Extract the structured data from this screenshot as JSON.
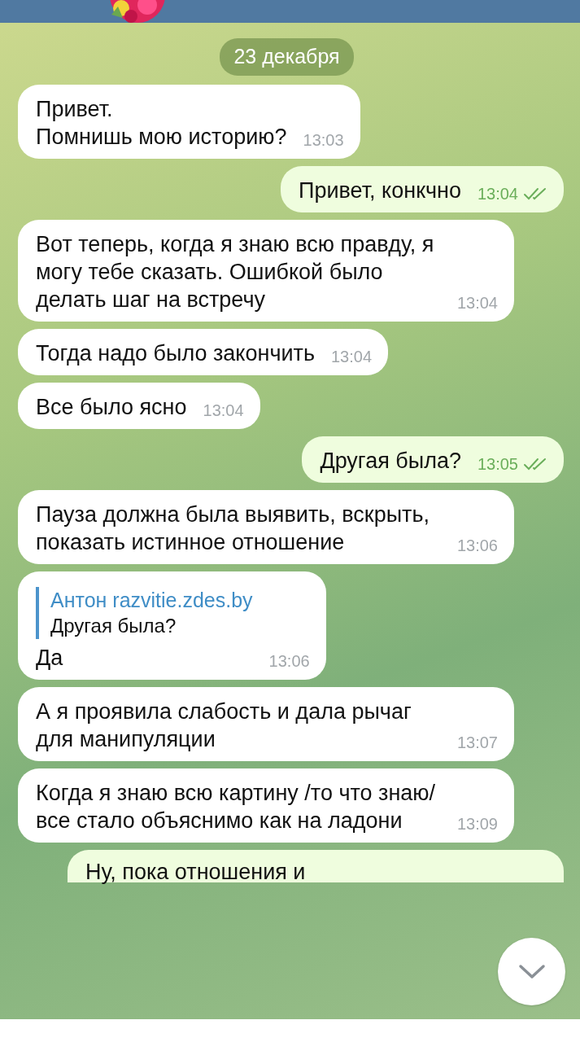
{
  "date_divider": "23 декабря",
  "messages": [
    {
      "kind": "text",
      "outgoing": false,
      "text": "Привет.\nПомнишь мою историю?",
      "time": "13:03"
    },
    {
      "kind": "text",
      "outgoing": true,
      "read": true,
      "text": "Привет, конкчно",
      "time": "13:04"
    },
    {
      "kind": "text",
      "outgoing": false,
      "text": "Вот теперь, когда я знаю всю правду, я могу тебе сказать. Ошибкой было делать шаг на встречу",
      "time": "13:04"
    },
    {
      "kind": "text",
      "outgoing": false,
      "text": "Тогда надо было закончить",
      "time": "13:04"
    },
    {
      "kind": "text",
      "outgoing": false,
      "text": "Все было ясно",
      "time": "13:04"
    },
    {
      "kind": "text",
      "outgoing": true,
      "read": true,
      "text": "Другая была?",
      "time": "13:05"
    },
    {
      "kind": "text",
      "outgoing": false,
      "text": "Пауза должна была выявить, вскрыть, показать истинное отношение",
      "time": "13:06"
    },
    {
      "kind": "reply",
      "outgoing": false,
      "quote_author": "Антон razvitie.zdes.by",
      "quote_text": "Другая была?",
      "text": "Да",
      "time": "13:06"
    },
    {
      "kind": "text",
      "outgoing": false,
      "text": "А я проявила слабость и дала рычаг для манипуляции",
      "time": "13:07"
    },
    {
      "kind": "text",
      "outgoing": false,
      "text": "Когда я знаю всю картину /то что знаю/ все стало объяснимо как на ладони",
      "time": "13:09"
    },
    {
      "kind": "partial",
      "outgoing": true,
      "text": "Ну, пока отношения и"
    }
  ]
}
